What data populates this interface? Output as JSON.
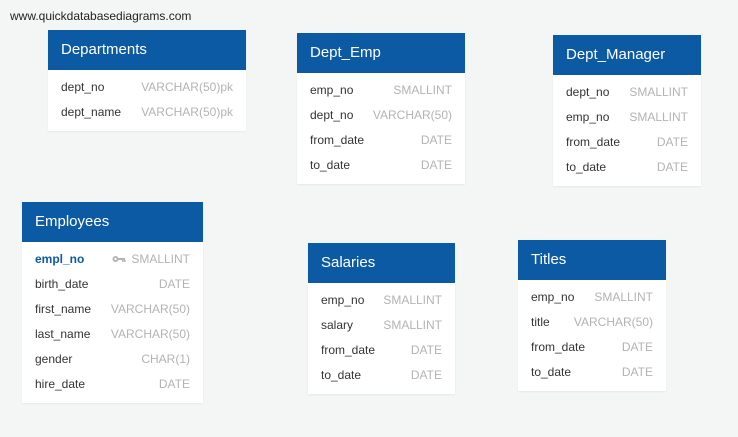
{
  "watermark": "www.quickdatabasediagrams.com",
  "tables": [
    {
      "name": "Departments",
      "fields": [
        {
          "name": "dept_no",
          "type": "VARCHAR(50)pk"
        },
        {
          "name": "dept_name",
          "type": "VARCHAR(50)pk"
        }
      ]
    },
    {
      "name": "Dept_Emp",
      "fields": [
        {
          "name": "emp_no",
          "type": "SMALLINT"
        },
        {
          "name": "dept_no",
          "type": "VARCHAR(50)"
        },
        {
          "name": "from_date",
          "type": "DATE"
        },
        {
          "name": "to_date",
          "type": "DATE"
        }
      ]
    },
    {
      "name": "Dept_Manager",
      "fields": [
        {
          "name": "dept_no",
          "type": "SMALLINT"
        },
        {
          "name": "emp_no",
          "type": "SMALLINT"
        },
        {
          "name": "from_date",
          "type": "DATE"
        },
        {
          "name": "to_date",
          "type": "DATE"
        }
      ]
    },
    {
      "name": "Employees",
      "fields": [
        {
          "name": "empl_no",
          "type": "SMALLINT",
          "primary_key": true
        },
        {
          "name": "birth_date",
          "type": "DATE"
        },
        {
          "name": "first_name",
          "type": "VARCHAR(50)"
        },
        {
          "name": "last_name",
          "type": "VARCHAR(50)"
        },
        {
          "name": "gender",
          "type": "CHAR(1)"
        },
        {
          "name": "hire_date",
          "type": "DATE"
        }
      ]
    },
    {
      "name": "Salaries",
      "fields": [
        {
          "name": "emp_no",
          "type": "SMALLINT"
        },
        {
          "name": "salary",
          "type": "SMALLINT"
        },
        {
          "name": "from_date",
          "type": "DATE"
        },
        {
          "name": "to_date",
          "type": "DATE"
        }
      ]
    },
    {
      "name": "Titles",
      "fields": [
        {
          "name": "emp_no",
          "type": "SMALLINT"
        },
        {
          "name": "title",
          "type": "VARCHAR(50)"
        },
        {
          "name": "from_date",
          "type": "DATE"
        },
        {
          "name": "to_date",
          "type": "DATE"
        }
      ]
    }
  ],
  "colors": {
    "header": "#0b5aa3",
    "background": "#f4f6f5",
    "type_text": "#b3b3b3",
    "primary_key_text": "#0b5aa3"
  },
  "icons": {
    "primary_key": "key-icon"
  }
}
